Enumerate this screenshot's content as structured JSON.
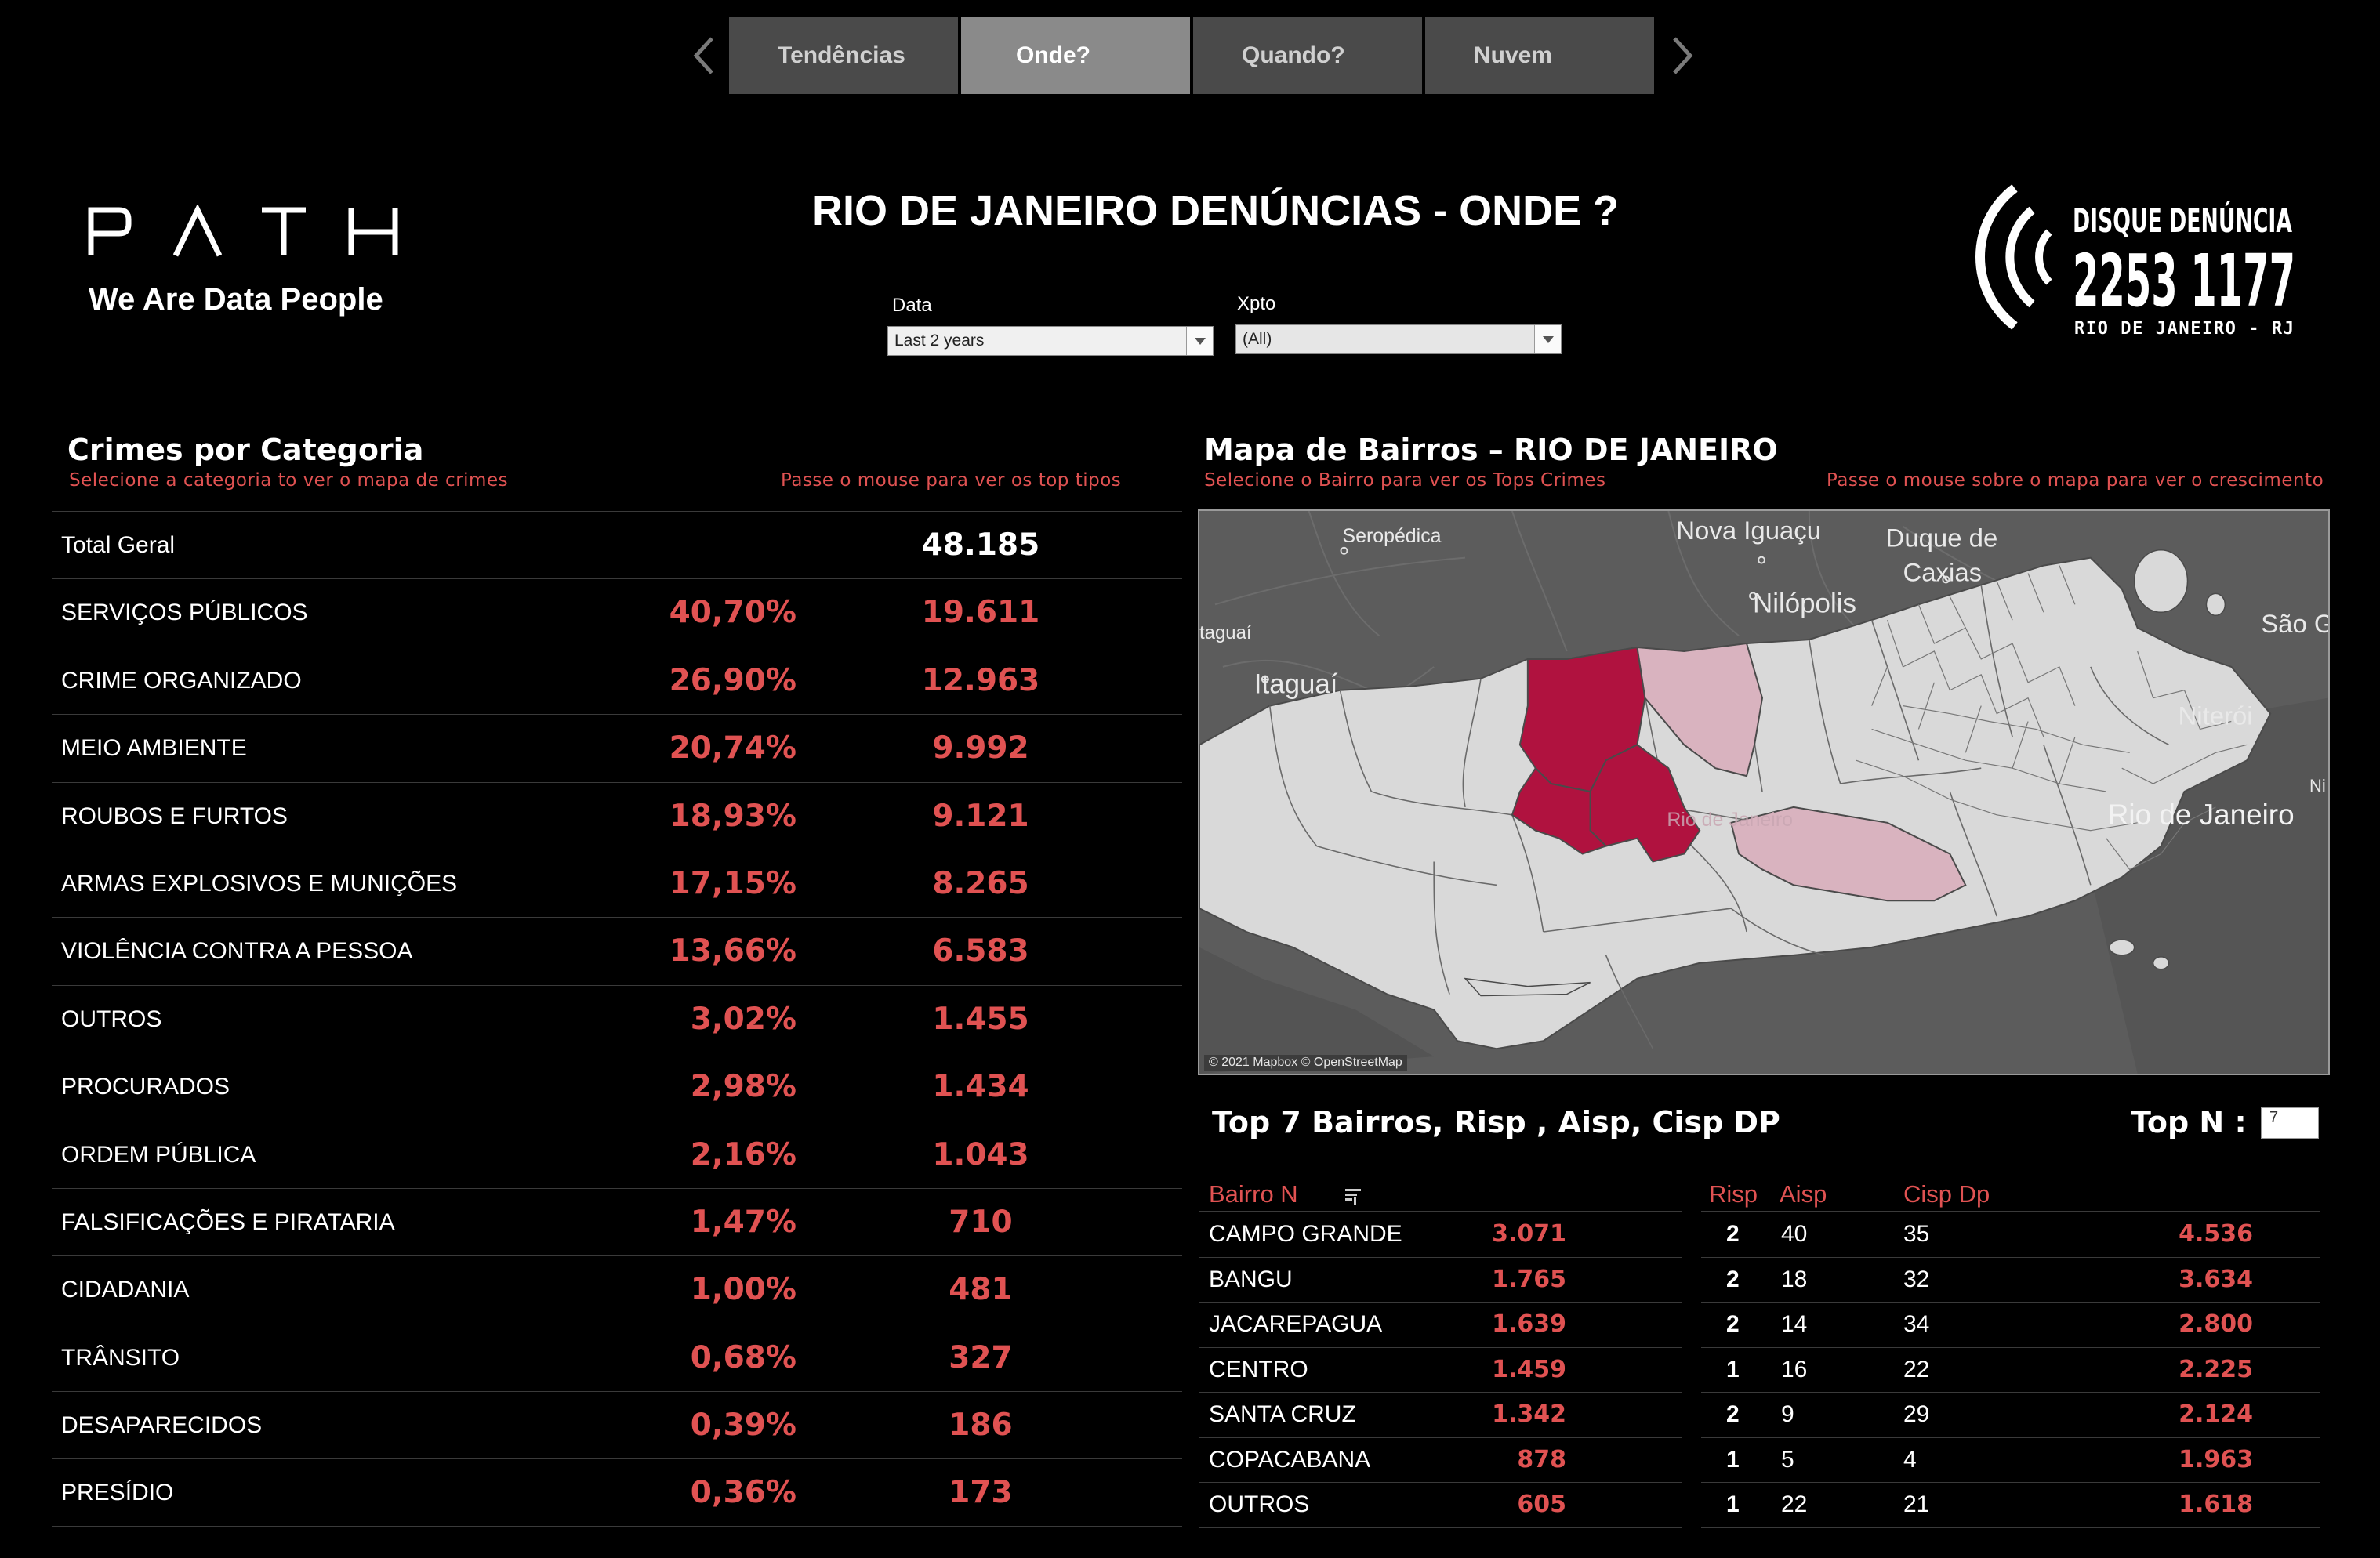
{
  "nav": {
    "tabs": [
      {
        "label": "Tendências",
        "active": false
      },
      {
        "label": "Onde?",
        "active": true
      },
      {
        "label": "Quando?",
        "active": false
      },
      {
        "label": "Nuvem",
        "active": false
      }
    ],
    "prev_icon": "chevron-left-icon",
    "next_icon": "chevron-right-icon"
  },
  "brand": {
    "logo_text": "PATH",
    "tagline": "We Are Data People"
  },
  "header": {
    "title": "RIO DE JANEIRO DENÚNCIAS -  ONDE ?"
  },
  "filters": {
    "data": {
      "label": "Data",
      "value": "Last 2 years"
    },
    "xpto": {
      "label": "Xpto",
      "value": "(All)"
    }
  },
  "hotline_logo": {
    "line1": "DISQUE DENÚNCIA",
    "line2": "2253 1177",
    "line3": "RIO DE JANEIRO - RJ"
  },
  "categories": {
    "title": "Crimes por Categoria",
    "hint_left": "Selecione a categoria to ver o mapa de crimes",
    "hint_right": "Passe o mouse para ver os  top  tipos",
    "total": {
      "name": "Total Geral",
      "value": "48.185"
    },
    "rows": [
      {
        "name": "SERVIÇOS PÚBLICOS",
        "pct": "40,70%",
        "value": "19.611"
      },
      {
        "name": "CRIME ORGANIZADO",
        "pct": "26,90%",
        "value": "12.963"
      },
      {
        "name": "MEIO AMBIENTE",
        "pct": "20,74%",
        "value": "9.992"
      },
      {
        "name": "ROUBOS E FURTOS",
        "pct": "18,93%",
        "value": "9.121"
      },
      {
        "name": "ARMAS EXPLOSIVOS E MUNIÇÕES",
        "pct": "17,15%",
        "value": "8.265"
      },
      {
        "name": "VIOLÊNCIA CONTRA A PESSOA",
        "pct": "13,66%",
        "value": "6.583"
      },
      {
        "name": "OUTROS",
        "pct": "3,02%",
        "value": "1.455"
      },
      {
        "name": "PROCURADOS",
        "pct": "2,98%",
        "value": "1.434"
      },
      {
        "name": "ORDEM PÚBLICA",
        "pct": "2,16%",
        "value": "1.043"
      },
      {
        "name": "FALSIFICAÇÕES E PIRATARIA",
        "pct": "1,47%",
        "value": "710"
      },
      {
        "name": "CIDADANIA",
        "pct": "1,00%",
        "value": "481"
      },
      {
        "name": "TRÂNSITO",
        "pct": "0,68%",
        "value": "327"
      },
      {
        "name": "DESAPARECIDOS",
        "pct": "0,39%",
        "value": "186"
      },
      {
        "name": "PRESÍDIO",
        "pct": "0,36%",
        "value": "173"
      }
    ]
  },
  "map": {
    "title": "Mapa de Bairros  – RIO DE JANEIRO",
    "hint_left": "Selecione o Bairro  para ver os Tops Crimes",
    "hint_right": "Passe o mouse sobre o mapa para ver o crescimento",
    "place_labels": {
      "seropedica": "Seropédica",
      "nova_iguacu": "Nova Iguaçu",
      "duque_line1": "Duque de",
      "duque_line2": "Caxias",
      "nilopolis": "Nilópolis",
      "sao": "São G",
      "itaguai_edge": "taguaí",
      "itaguai": "Itaguaí",
      "niteroi": "Niterói",
      "ni": "Ni",
      "rio_de_janeiro": "Rio de Janeiro",
      "rio_right": "Rio de Janeiro"
    },
    "credit": "© 2021 Mapbox © OpenStreetMap",
    "colors": {
      "land_dark": "#5c5c5c",
      "bairro": "#d9d9d9",
      "highlight": "#b0123f",
      "highlight_light": "#d9b3bf"
    }
  },
  "top7": {
    "title": "Top 7  Bairros, Risp , Aisp, Cisp DP",
    "topn_label": "Top N :",
    "topn_value": "7",
    "headers": {
      "bairro": "Bairro N",
      "risp": "Risp",
      "aisp": "Aisp",
      "cisp": "Cisp Dp"
    },
    "sort_icon": "sort-icon",
    "rows": [
      {
        "bairro": "CAMPO GRANDE",
        "count": "3.071",
        "risp": "2",
        "aisp": "40",
        "cisp": "35",
        "cisp_count": "4.536"
      },
      {
        "bairro": "BANGU",
        "count": "1.765",
        "risp": "2",
        "aisp": "18",
        "cisp": "32",
        "cisp_count": "3.634"
      },
      {
        "bairro": "JACAREPAGUA",
        "count": "1.639",
        "risp": "2",
        "aisp": "14",
        "cisp": "34",
        "cisp_count": "2.800"
      },
      {
        "bairro": "CENTRO",
        "count": "1.459",
        "risp": "1",
        "aisp": "16",
        "cisp": "22",
        "cisp_count": "2.225"
      },
      {
        "bairro": "SANTA CRUZ",
        "count": "1.342",
        "risp": "2",
        "aisp": "9",
        "cisp": "29",
        "cisp_count": "2.124"
      },
      {
        "bairro": "COPACABANA",
        "count": "878",
        "risp": "1",
        "aisp": "5",
        "cisp": "4",
        "cisp_count": "1.963"
      },
      {
        "bairro": "OUTROS",
        "count": "605",
        "risp": "1",
        "aisp": "22",
        "cisp": "21",
        "cisp_count": "1.618"
      }
    ]
  }
}
